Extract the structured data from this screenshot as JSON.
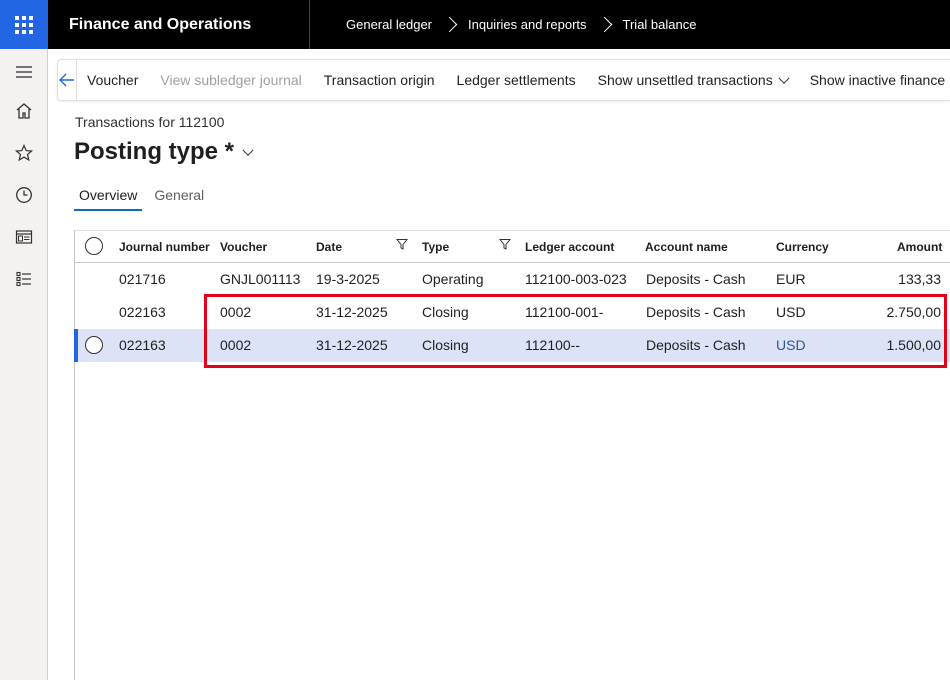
{
  "topbar": {
    "app_title": "Finance and Operations",
    "breadcrumbs": [
      "General ledger",
      "Inquiries and reports",
      "Trial balance"
    ]
  },
  "leftrail": {
    "icons": [
      "hamburger-menu-icon",
      "home-icon",
      "star-icon",
      "clock-icon",
      "workspace-icon",
      "list-icon"
    ]
  },
  "actionpane": {
    "voucher": "Voucher",
    "view_subledger": "View subledger journal",
    "transaction_origin": "Transaction origin",
    "ledger_settlements": "Ledger settlements",
    "show_unsettled": "Show unsettled transactions",
    "show_inactive": "Show inactive finance"
  },
  "page": {
    "caption": "Transactions for 112100",
    "title": "Posting type *"
  },
  "tabs": {
    "overview": "Overview",
    "general": "General",
    "active": "Overview"
  },
  "grid": {
    "columns": [
      "Journal number",
      "Voucher",
      "Date",
      "Type",
      "Ledger account",
      "Account name",
      "Currency",
      "Amount"
    ],
    "rows": [
      [
        "021716",
        "GNJL001113",
        "19-3-2025",
        "Operating",
        "112100-003-023",
        "Deposits - Cash",
        "EUR",
        "133,33"
      ],
      [
        "022163",
        "0002",
        "31-12-2025",
        "Closing",
        "112100-001-",
        "Deposits - Cash",
        "USD",
        "2.750,00"
      ],
      [
        "022163",
        "0002",
        "31-12-2025",
        "Closing",
        "112100--",
        "Deposits - Cash",
        "USD",
        "1.500,00"
      ]
    ],
    "selected_row": 2
  },
  "colors": {
    "accent": "#2266e3",
    "selected_row": "#dce3f7",
    "highlight_box": "#e3001b",
    "topbar": "#000000"
  }
}
